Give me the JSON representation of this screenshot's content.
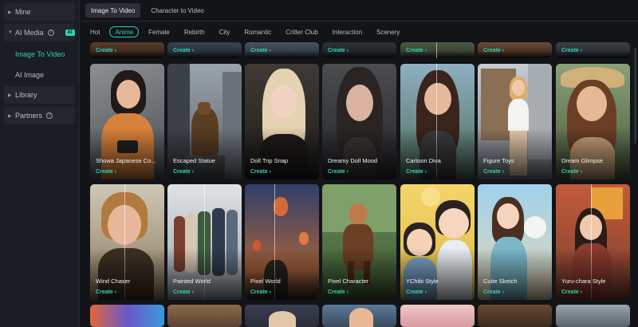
{
  "sidebar": {
    "items": [
      {
        "label": "Mine"
      },
      {
        "label": "AI Media",
        "badge": "AI"
      },
      {
        "label": "Image To Video"
      },
      {
        "label": "AI Image"
      },
      {
        "label": "Library"
      },
      {
        "label": "Partners"
      }
    ]
  },
  "top_tabs": [
    "Image To Video",
    "Character to Video"
  ],
  "categories": [
    "Hot",
    "Anime",
    "Female",
    "Rebirth",
    "City",
    "Romantic",
    "Critter Club",
    "Interaction",
    "Scenery"
  ],
  "create_label": "Create ›",
  "row1": [
    {
      "title": "Showa Japanese Co..."
    },
    {
      "title": "Escaped Statue"
    },
    {
      "title": "Doll Trip Snap"
    },
    {
      "title": "Dreamy Doll Mood"
    },
    {
      "title": "Cartoon Diva"
    },
    {
      "title": "Figure Toys"
    },
    {
      "title": "Dream Glimpse"
    }
  ],
  "row2": [
    {
      "title": "Wind Chaser"
    },
    {
      "title": "Painted World"
    },
    {
      "title": "Pixel World"
    },
    {
      "title": "Pixel Character"
    },
    {
      "title": "YChibi Style"
    },
    {
      "title": "Cutie Sketch"
    },
    {
      "title": "Yuru-chara Style"
    }
  ],
  "colors": {
    "accent": "#2fd1b6",
    "background": "#121418",
    "sidebar": "#1a1d22"
  }
}
